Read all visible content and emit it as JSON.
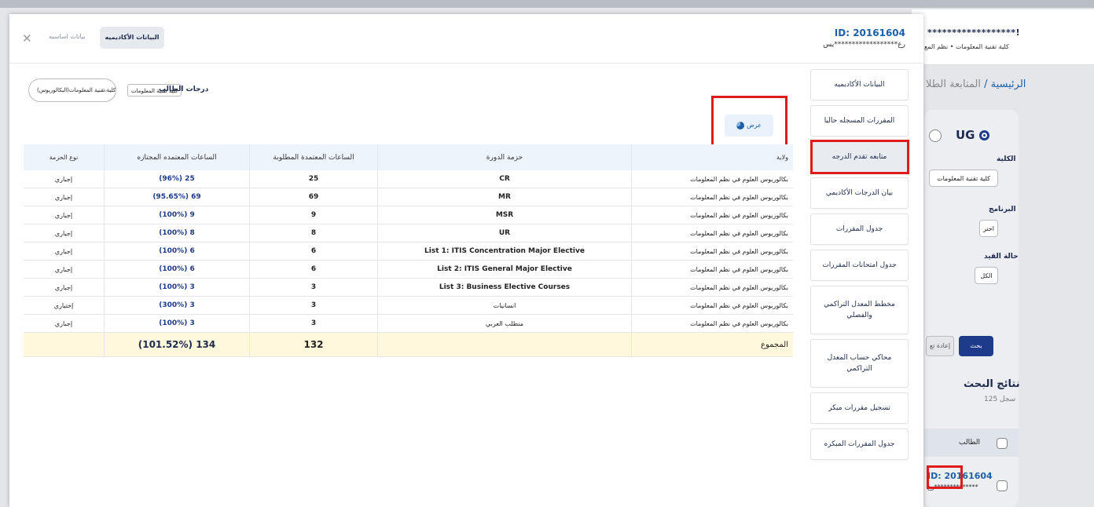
{
  "background": {
    "masked_name": "******************!",
    "subtitle": "كلية تقنية المعلومات  •  نظم المع",
    "breadcrumb_home": "الرئيسية",
    "breadcrumb_sep": "/",
    "breadcrumb_current": "المتابعة الطلا",
    "level_option": "UG",
    "college_label": "الكلية",
    "college_value": "كلية تقنية المعلومات",
    "program_label": "البرنامج",
    "program_value": "اختر",
    "status_label": "حالة القيد",
    "status_value": "الكل",
    "search_button": "بحث",
    "reset_button": "إعادة تع",
    "results_title": "نتائج البحث",
    "results_count": "125 سجل",
    "col_student": "الطالب",
    "row_id": "ID: 20161604",
    "row_mask": "رغ**************"
  },
  "modal": {
    "student_id": "ID: 20161604",
    "student_name_masked": "رغ******************يس",
    "tab_basic": "بيانات اساسيه",
    "tab_academic": "البيانات الأكاديميه",
    "close_symbol": "✕",
    "grades_label": "درجات الطالب",
    "faculty_value": "كلية تقنية المعلومات",
    "program_select": "كلية تقنية المعلومات(البكالوريوس)",
    "view_button": "عرض",
    "table": {
      "headers": {
        "major": "ولاية",
        "package": "حزمة الدورة",
        "required": "الساعات المعتمدة المطلوبة",
        "selected": "الساعات المعتمده المجتازه",
        "type": "نوع الحزمة"
      },
      "rows": [
        {
          "major": "بكالوريوس العلوم في نظم المعلومات",
          "package": "CR",
          "required": "25",
          "selected": "(96%) 25",
          "type": "إجباري"
        },
        {
          "major": "بكالوريوس العلوم في نظم المعلومات",
          "package": "MR",
          "required": "69",
          "selected": "(95.65%) 69",
          "type": "إجباري"
        },
        {
          "major": "بكالوريوس العلوم في نظم المعلومات",
          "package": "MSR",
          "required": "9",
          "selected": "(100%) 9",
          "type": "إجباري"
        },
        {
          "major": "بكالوريوس العلوم في نظم المعلومات",
          "package": "UR",
          "required": "8",
          "selected": "(100%) 8",
          "type": "إجباري"
        },
        {
          "major": "بكالوريوس العلوم في نظم المعلومات",
          "package": "List 1: ITIS Concentration Major Elective",
          "required": "6",
          "selected": "(100%) 6",
          "type": "إجباري"
        },
        {
          "major": "بكالوريوس العلوم في نظم المعلومات",
          "package": "List 2: ITIS General Major Elective",
          "required": "6",
          "selected": "(100%) 6",
          "type": "إجباري"
        },
        {
          "major": "بكالوريوس العلوم في نظم المعلومات",
          "package": "List 3: Business Elective Courses",
          "required": "3",
          "selected": "(100%) 3",
          "type": "إجباري"
        },
        {
          "major": "بكالوريوس العلوم في نظم المعلومات",
          "package": "انسانيات",
          "required": "3",
          "selected": "(300%) 3",
          "type": "إختياري"
        },
        {
          "major": "بكالوريوس العلوم في نظم المعلومات",
          "package": "متطلب العربي",
          "required": "3",
          "selected": "(100%) 3",
          "type": "إجباري"
        }
      ],
      "total": {
        "label": "المجموع",
        "required": "132",
        "selected": "(101.52%) 134"
      }
    },
    "side_menu": [
      "البيانات الأكاديميه",
      "المقررات المسجله حاليا",
      "متابعه تقدم الدرجه",
      "بيان الدرجات الأكاديمي",
      "جدول المقررات",
      "جدول امتحانات المقررات",
      "مخطط المعدل التراكمي والفصلي",
      "محاكي حساب المعدل التراكمي",
      "تسجيل مقررات مبكر",
      "جدول المقررات المبكره"
    ],
    "active_menu_index": 2
  },
  "colors": {
    "accent": "#1e5fa8",
    "primary_dark": "#1e3a8a",
    "highlight_box": "#e11b1b",
    "total_row": "#fff8dc"
  }
}
